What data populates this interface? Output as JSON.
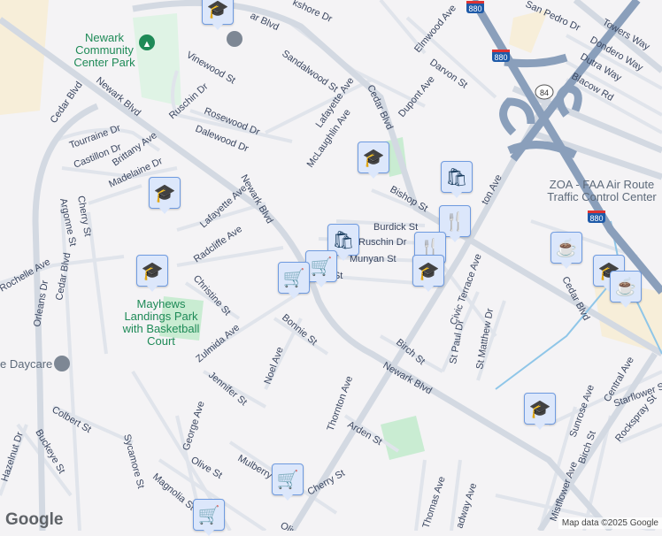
{
  "streets": [
    "ar Blvd",
    "kshore Dr",
    "Vinewood St",
    "Sandalwood St",
    "Ruschin Dr",
    "Rosewood Dr",
    "Dalewood Dr",
    "Newark Blvd",
    "Cedar Blvd",
    "Tourraine Dr",
    "Castillon Dr",
    "Brittany Ave",
    "Madelaine Dr",
    "Lafayette Ave",
    "McLaughlin Ave",
    "Elmwood Ave",
    "Darvon St",
    "Dupont Ave",
    "Cedar Blvd",
    "San Pedro Dr",
    "Towers Way",
    "Dondero Way",
    "Dutra Way",
    "Blacow Rd",
    "Bishop St",
    "Burdick St",
    "Ruschin Dr",
    "Munyan St",
    "ner St",
    "ton Ave",
    "Newark Blvd",
    "Lafayette Ave",
    "Radcliffe Ave",
    "Christine St",
    "Argonne St",
    "Cherry St",
    "Cedar Blvd",
    "Rochelle Ave",
    "Orleans Dr",
    "Zulmida Ave",
    "Bonnie St",
    "Noel Ave",
    "Jennifer St",
    "Civic Terrace Ave",
    "St Paul Dr",
    "St Matthew Dr",
    "Cedar Blvd",
    "Birch St",
    "Newark Blvd",
    "Thornton Ave",
    "Central Ave",
    "Starflower St",
    "Sunrose Ave",
    "Rockspray St",
    "Birch St",
    "Mistflower Ave",
    "Colbert St",
    "Buckeye St",
    "Hazelnut Dr",
    "Sycamore St",
    "George Ave",
    "Olive St",
    "Magnolia St",
    "Mulberry",
    "Cherry St",
    "Arden St",
    "Thomas Ave",
    "adway Ave",
    "Olive"
  ],
  "parks": {
    "newark_community": [
      "Newark",
      "Community",
      "Center Park"
    ],
    "mayhews": [
      "Mayhews",
      "Landings Park",
      "with Basketball",
      "Court"
    ]
  },
  "poi": {
    "zoa": [
      "ZOA - FAA Air Route",
      "Traffic Control Center"
    ],
    "daycare": "e Daycare"
  },
  "shields": {
    "i880": "880",
    "sr84": "84"
  },
  "markers": [
    {
      "type": "school",
      "glyph": "🎓"
    },
    {
      "type": "school",
      "glyph": "🎓"
    },
    {
      "type": "school",
      "glyph": "🎓"
    },
    {
      "type": "school",
      "glyph": "🎓"
    },
    {
      "type": "shopping-bag",
      "glyph": "🛍"
    },
    {
      "type": "restaurant",
      "glyph": "🍴"
    },
    {
      "type": "restaurant",
      "glyph": "🍴"
    },
    {
      "type": "shopping-bag",
      "glyph": "🛍"
    },
    {
      "type": "shopping-cart",
      "glyph": "🛒"
    },
    {
      "type": "shopping-cart",
      "glyph": "🛒"
    },
    {
      "type": "school",
      "glyph": "🎓"
    },
    {
      "type": "cafe",
      "glyph": "☕"
    },
    {
      "type": "school",
      "glyph": "🎓"
    },
    {
      "type": "cafe",
      "glyph": "☕"
    },
    {
      "type": "school",
      "glyph": "🎓"
    },
    {
      "type": "shopping-cart",
      "glyph": "🛒"
    },
    {
      "type": "shopping-cart",
      "glyph": "🛒"
    }
  ],
  "footer": {
    "logo": "Google",
    "attribution": "Map data ©2025 Google"
  },
  "colors": {
    "road": "#dde2ea",
    "highway": "#8a9fbb",
    "park": "#c9ecd2",
    "land": "#f4f3f5",
    "commercial": "#f7eed9"
  }
}
